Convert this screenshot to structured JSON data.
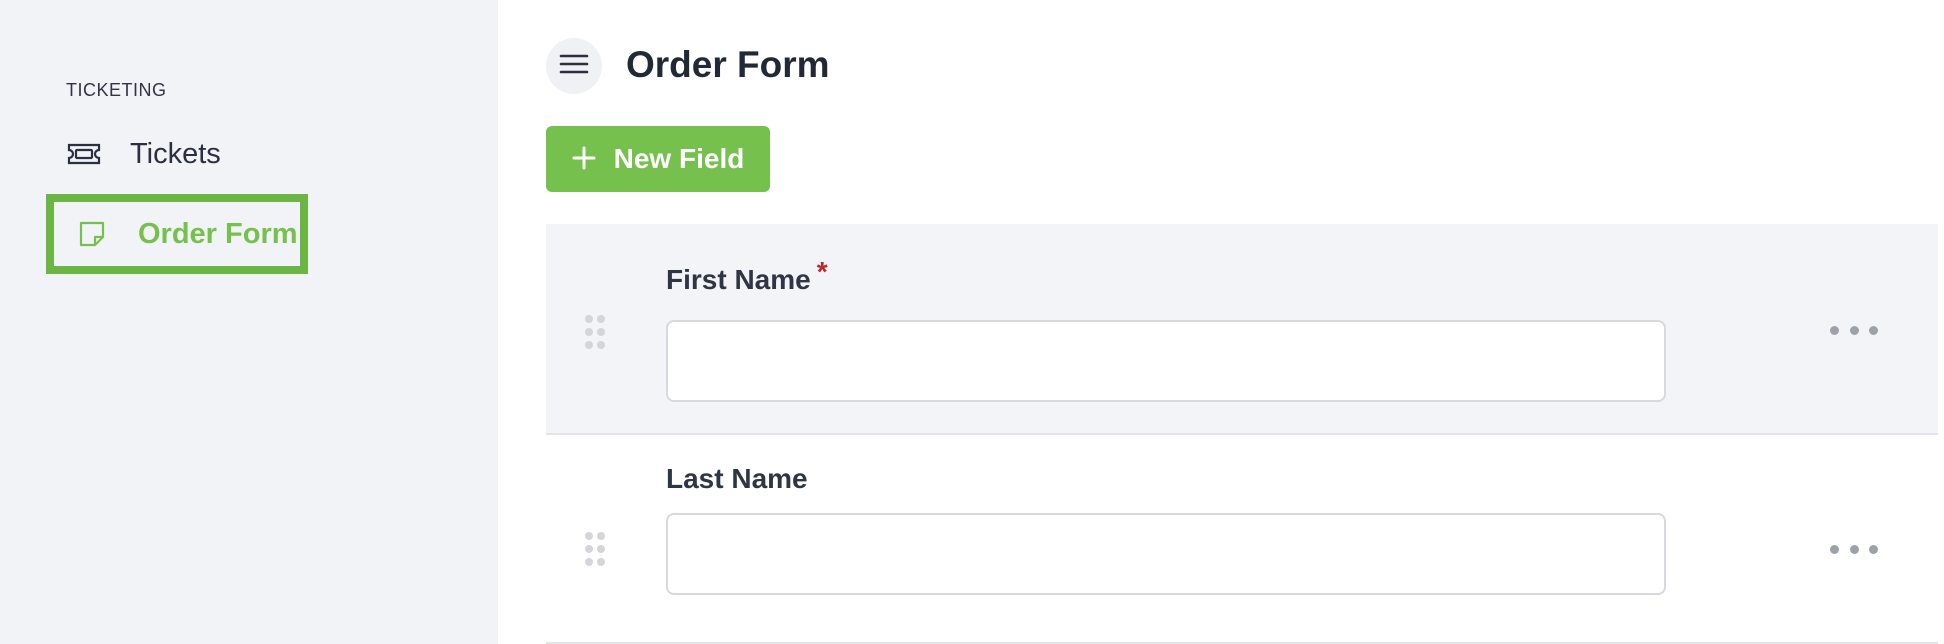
{
  "sidebar": {
    "section_label": "TICKETING",
    "items": [
      {
        "label": "Tickets",
        "icon": "ticket-icon",
        "active": false
      },
      {
        "label": "Order Form",
        "icon": "note-icon",
        "active": true
      }
    ]
  },
  "header": {
    "menu_icon": "hamburger-icon",
    "title": "Order Form"
  },
  "toolbar": {
    "new_field_label": "New Field",
    "new_field_icon": "plus-icon"
  },
  "fields": [
    {
      "label": "First Name",
      "required": true,
      "required_mark": "*",
      "value": ""
    },
    {
      "label": "Last Name",
      "required": false,
      "value": ""
    }
  ],
  "colors": {
    "accent": "#76c04e",
    "highlight_border": "#6ab543",
    "required": "#c0272d",
    "sidebar_bg": "#f2f3f6"
  }
}
